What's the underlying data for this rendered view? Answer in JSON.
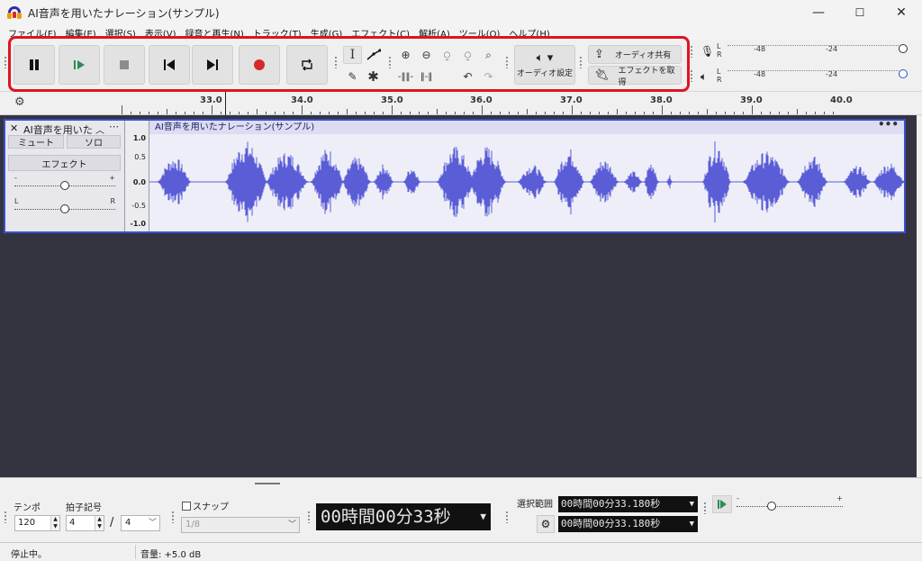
{
  "window": {
    "title": "AI音声を用いたナレーション(サンプル)",
    "minimize": "—",
    "maximize": "☐",
    "close": "✕"
  },
  "menu": [
    "ファイル(F)",
    "編集(E)",
    "選択(S)",
    "表示(V)",
    "録音と再生(N)",
    "トラック(T)",
    "生成(G)",
    "エフェクト(C)",
    "解析(A)",
    "ツール(O)",
    "ヘルプ(H)"
  ],
  "toolbar": {
    "audio_setup_label": "オーディオ設定",
    "share_audio_label": "オーディオ共有",
    "get_effects_label": "エフェクトを取得"
  },
  "meters": {
    "record": {
      "left": "L",
      "right": "R",
      "ticks": [
        "-48",
        "-24"
      ]
    },
    "play": {
      "left": "L",
      "right": "R",
      "ticks": [
        "-48",
        "-24"
      ]
    }
  },
  "ruler": {
    "ticks": [
      "33.0",
      "34.0",
      "35.0",
      "36.0",
      "37.0",
      "38.0",
      "39.0",
      "40.0"
    ]
  },
  "track": {
    "name": "AI音声を用いた",
    "mute": "ミュート",
    "solo": "ソロ",
    "effects": "エフェクト",
    "gain_minus": "-",
    "gain_plus": "+",
    "pan_left": "L",
    "pan_right": "R",
    "gain_level": 0.5,
    "pan_level": 0.5,
    "clip_name": "AI音声を用いたナレーション(サンプル)",
    "clip_menu": "•••",
    "scale": [
      "1.0",
      "0.5",
      "0.0",
      "-0.5",
      "-1.0"
    ],
    "waveform_color": "#5a5dd6"
  },
  "bottom": {
    "tempo_label": "テンポ",
    "tempo_value": "120",
    "timesig_label": "拍子記号",
    "timesig_top": "4",
    "timesig_slash": "/",
    "timesig_bottom": "4",
    "snap_label": "スナップ",
    "snap_value": "1/8",
    "time_display": "00時間00分33秒",
    "selection_label": "選択範囲",
    "sel_start": "00時間00分33.180秒",
    "sel_end": "00時間00分33.180秒",
    "speed_minus": "-",
    "speed_plus": "+"
  },
  "status": {
    "state": "停止中。",
    "volume": "音量: +5.0 dB"
  },
  "colors": {
    "accent_highlight": "#e0141e",
    "track_border": "#3b4fd0",
    "record": "#d42a2a",
    "play": "#2e8b57"
  }
}
